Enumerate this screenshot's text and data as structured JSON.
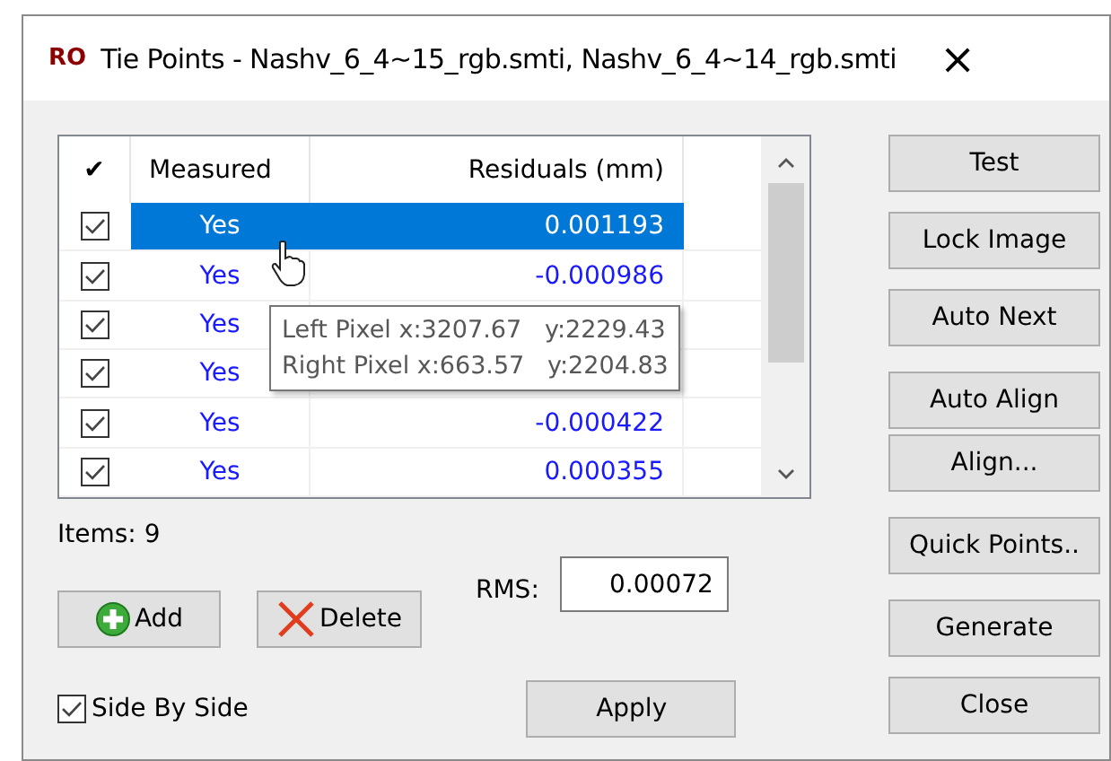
{
  "window": {
    "icon_text": "RO",
    "title": "Tie Points - Nashv_6_4~15_rgb.smti, Nashv_6_4~14_rgb.smti",
    "close": "×"
  },
  "table": {
    "columns": [
      "✔",
      "Measured",
      "Residuals (mm)"
    ],
    "rows": [
      {
        "checked": true,
        "measured": "Yes",
        "residual": "0.001193",
        "selected": true
      },
      {
        "checked": true,
        "measured": "Yes",
        "residual": "-0.000986",
        "selected": false
      },
      {
        "checked": true,
        "measured": "Yes",
        "selected": false
      },
      {
        "checked": true,
        "measured": "Yes",
        "selected": false
      },
      {
        "checked": true,
        "measured": "Yes",
        "residual": "-0.000422",
        "selected": false
      },
      {
        "checked": true,
        "measured": "Yes",
        "residual": "0.000355",
        "selected": false
      }
    ]
  },
  "tooltip": [
    "Left Pixel x:3207.67   y:2229.43",
    "Right Pixel x:663.57   y:2204.83"
  ],
  "items_count": "Items: 9",
  "add_button": "Add",
  "delete_button": "Delete",
  "rms": {
    "label": "RMS:",
    "value": "0.00072"
  },
  "side_by_side": {
    "label": "Side By Side",
    "checked": true
  },
  "apply_button": "Apply",
  "side_button_groups": [
    [
      "Test",
      "Lock Image",
      "Auto Next"
    ],
    [
      "Auto Align",
      "Align..."
    ],
    [
      "Quick Points.."
    ],
    [
      "Generate",
      "Close"
    ]
  ]
}
